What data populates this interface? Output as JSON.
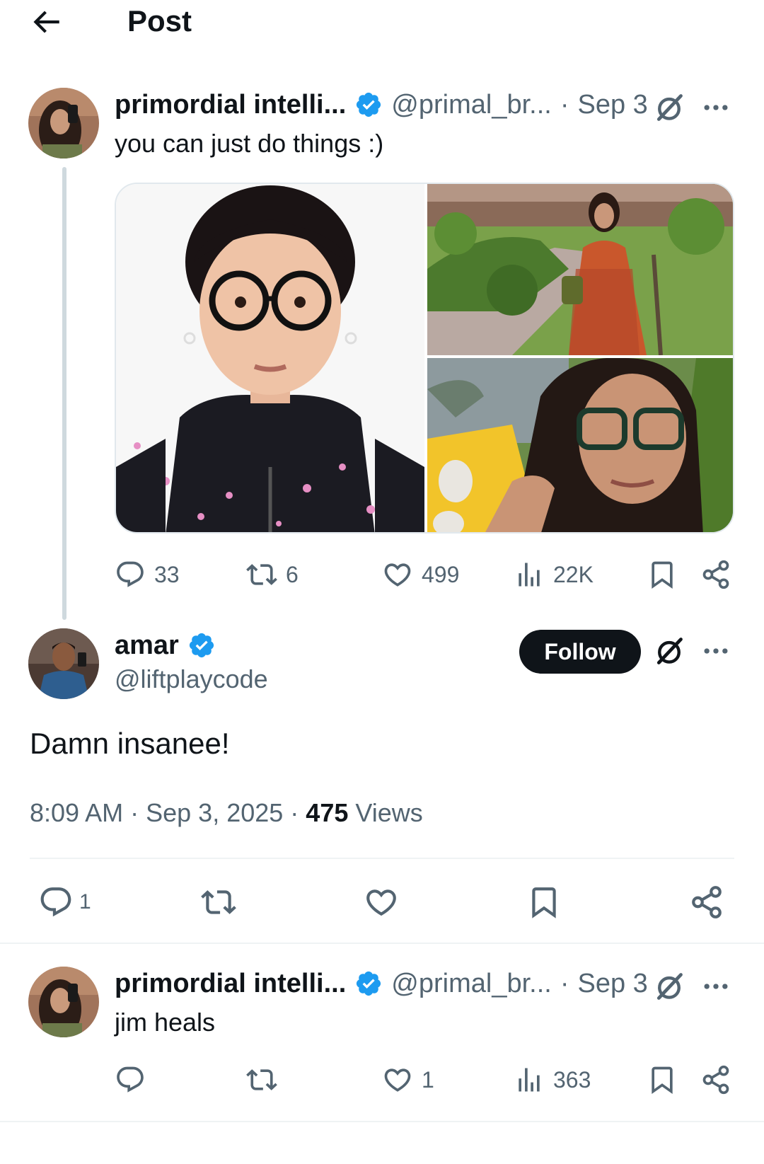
{
  "header": {
    "title": "Post"
  },
  "parent_post": {
    "display_name": "primordial intelli...",
    "handle": "@primal_br...",
    "separator": "·",
    "date": "Sep 3",
    "text": "you can just do things :)",
    "stats": {
      "replies": "33",
      "reposts": "6",
      "likes": "499",
      "views": "22K"
    }
  },
  "main_post": {
    "display_name": "amar",
    "handle": "@liftplaycode",
    "follow_label": "Follow",
    "text": "Damn insanee!",
    "time": "8:09 AM",
    "date": "Sep 3, 2025",
    "views_count": "475",
    "views_label": "Views",
    "replies": "1"
  },
  "reply_post": {
    "display_name": "primordial intelli...",
    "handle": "@primal_br...",
    "separator": "·",
    "date": "Sep 3",
    "text": "jim heals",
    "stats": {
      "likes": "1",
      "views": "363"
    }
  },
  "icons": {
    "back": "arrow-left-icon",
    "verified": "verified-badge-icon",
    "grok": "grok-icon",
    "more": "more-icon",
    "reply": "reply-icon",
    "repost": "repost-icon",
    "like": "heart-icon",
    "views": "views-icon",
    "bookmark": "bookmark-icon",
    "share": "share-icon"
  },
  "colors": {
    "verified": "#1d9bf0",
    "text": "#0f1419",
    "secondary": "#536471",
    "border": "#eff3f4",
    "button": "#0f1419"
  }
}
